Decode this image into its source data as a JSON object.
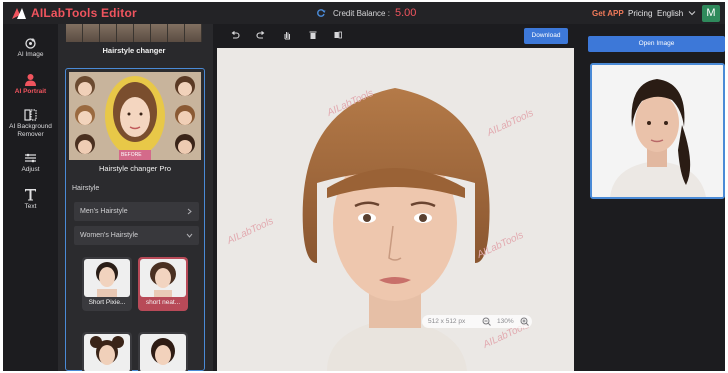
{
  "header": {
    "app_title": "AILabTools Editor",
    "credit_label": "Credit Balance :",
    "credit_value": "5.00",
    "get_app": "Get APP",
    "pricing": "Pricing",
    "language": "English",
    "avatar_letter": "M"
  },
  "nav": {
    "items": [
      {
        "label": "AI Image",
        "icon": "ai-image-icon"
      },
      {
        "label": "AI Portrait",
        "icon": "portrait-icon",
        "active": true
      },
      {
        "label": "AI Background Remover",
        "icon": "background-remover-icon"
      },
      {
        "label": "Adjust",
        "icon": "adjust-icon"
      },
      {
        "label": "Text",
        "icon": "text-icon"
      }
    ]
  },
  "panel": {
    "top_card_label": "Hairstyle changer",
    "pro_card_title": "Hairstyle changer Pro",
    "pro_card_badge": "BEFORE",
    "section_label": "Hairstyle",
    "mens_dropdown": "Men's Hairstyle",
    "womens_dropdown": "Women's Hairstyle",
    "styles": [
      {
        "caption": "Short Pixie..."
      },
      {
        "caption": "short neat...",
        "selected": true
      },
      {
        "caption": ""
      },
      {
        "caption": ""
      }
    ]
  },
  "toolbar": {
    "download_label": "Download",
    "tools": [
      "undo-icon",
      "redo-icon",
      "hand-icon",
      "trash-icon",
      "compare-icon"
    ]
  },
  "canvas": {
    "dimensions": "512 x 512 px",
    "zoom": "130%",
    "watermark": "AILabTools"
  },
  "right": {
    "open_image_label": "Open Image"
  },
  "colors": {
    "accent_red": "#f0545e",
    "accent_blue": "#3d78d8",
    "selected_tile": "#b84a58"
  }
}
